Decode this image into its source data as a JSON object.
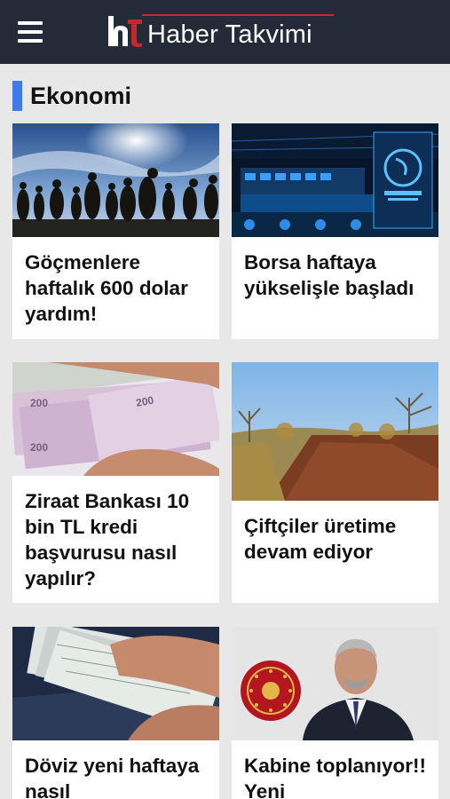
{
  "header": {
    "logo_text": "Haber Takvimi",
    "brand_color": "#232b39",
    "logo_accent": "#c9252c"
  },
  "section": {
    "title": "Ekonomi",
    "accent": "#3f7be8"
  },
  "articles": [
    {
      "title": "Göçmenlere haftalık 600 dolar yardım!",
      "image": "migrants-silhouette-photo"
    },
    {
      "title": "Borsa haftaya yükselişle başladı",
      "image": "borsa-istanbul-trading-floor-photo"
    },
    {
      "title": "Ziraat Bankası 10 bin TL kredi başvurusu nasıl yapılır?",
      "image": "turkish-lira-banknotes-photo"
    },
    {
      "title": "Çiftçiler üretime devam ediyor",
      "image": "farmland-field-photo"
    },
    {
      "title": "Döviz yeni haftaya nasıl",
      "image": "dollar-banknotes-photo"
    },
    {
      "title": "Kabine toplanıyor!! Yeni",
      "image": "president-portrait-photo"
    }
  ]
}
